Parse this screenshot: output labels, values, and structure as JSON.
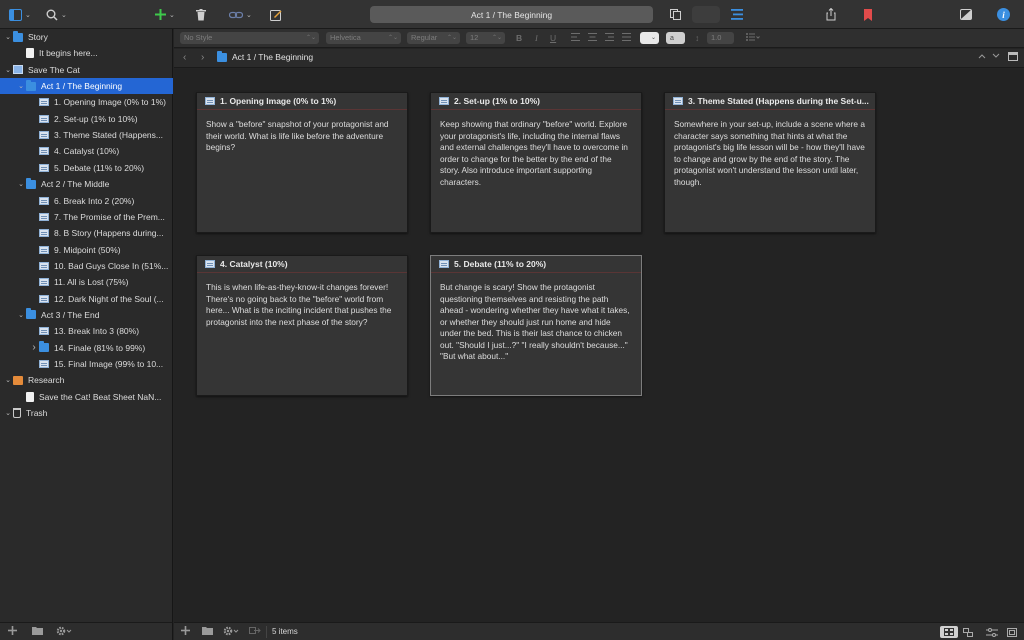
{
  "toolbar": {
    "title": "Act 1 / The Beginning",
    "colors": {
      "add": "#3ec94b",
      "bookmark": "#e24b4b",
      "info": "#3b8fe0",
      "binder": "#3b8fe0"
    }
  },
  "binder": {
    "items": [
      {
        "label": "Story",
        "depth": 0,
        "icon": "folder",
        "disclosure": "v"
      },
      {
        "label": "It begins here...",
        "depth": 1,
        "icon": "doc",
        "disclosure": ""
      },
      {
        "label": "Save The Cat",
        "depth": 0,
        "icon": "book",
        "disclosure": "v"
      },
      {
        "label": "Act 1 / The Beginning",
        "depth": 1,
        "icon": "folder",
        "disclosure": "v",
        "selected": true
      },
      {
        "label": "1. Opening Image (0% to 1%)",
        "depth": 2,
        "icon": "text",
        "disclosure": ""
      },
      {
        "label": "2. Set-up (1% to 10%)",
        "depth": 2,
        "icon": "text",
        "disclosure": ""
      },
      {
        "label": "3. Theme Stated (Happens...",
        "depth": 2,
        "icon": "text",
        "disclosure": ""
      },
      {
        "label": "4. Catalyst (10%)",
        "depth": 2,
        "icon": "text",
        "disclosure": ""
      },
      {
        "label": "5. Debate (11% to 20%)",
        "depth": 2,
        "icon": "text",
        "disclosure": ""
      },
      {
        "label": "Act 2 / The Middle",
        "depth": 1,
        "icon": "folder",
        "disclosure": "v"
      },
      {
        "label": "6. Break Into 2 (20%)",
        "depth": 2,
        "icon": "text",
        "disclosure": ""
      },
      {
        "label": "7. The Promise of the Prem...",
        "depth": 2,
        "icon": "text",
        "disclosure": ""
      },
      {
        "label": "8. B Story (Happens during...",
        "depth": 2,
        "icon": "text",
        "disclosure": ""
      },
      {
        "label": "9. Midpoint (50%)",
        "depth": 2,
        "icon": "text",
        "disclosure": ""
      },
      {
        "label": "10. Bad Guys Close In (51%...",
        "depth": 2,
        "icon": "text",
        "disclosure": ""
      },
      {
        "label": "11. All is Lost (75%)",
        "depth": 2,
        "icon": "text",
        "disclosure": ""
      },
      {
        "label": "12. Dark Night of the Soul (...",
        "depth": 2,
        "icon": "text",
        "disclosure": ""
      },
      {
        "label": "Act 3 / The End",
        "depth": 1,
        "icon": "folder",
        "disclosure": "v"
      },
      {
        "label": "13. Break Into 3 (80%)",
        "depth": 2,
        "icon": "text",
        "disclosure": ""
      },
      {
        "label": "14. Finale (81% to 99%)",
        "depth": 2,
        "icon": "folder",
        "disclosure": ">"
      },
      {
        "label": "15. Final Image (99% to 10...",
        "depth": 2,
        "icon": "text",
        "disclosure": ""
      },
      {
        "label": "Research",
        "depth": 0,
        "icon": "research",
        "disclosure": "v"
      },
      {
        "label": "Save the Cat! Beat Sheet NaN...",
        "depth": 1,
        "icon": "doc",
        "disclosure": ""
      },
      {
        "label": "Trash",
        "depth": 0,
        "icon": "trash",
        "disclosure": "v"
      }
    ]
  },
  "formatbar": {
    "style": "No Style",
    "font": "Helvetica",
    "weight": "Regular",
    "size": "12",
    "bold": "B",
    "italic": "I",
    "underline": "U",
    "line_spacing": "1.0"
  },
  "header": {
    "back": "‹",
    "forward": "›",
    "breadcrumb": "Act 1 / The Beginning"
  },
  "cards": [
    {
      "title": "1. Opening Image (0% to 1%)",
      "body": "Show a \"before\" snapshot of your protagonist and their world. What is life like before the adventure begins?"
    },
    {
      "title": "2. Set-up (1% to 10%)",
      "body": "Keep showing that ordinary \"before\" world. Explore your protagonist's life, including the internal flaws and external challenges they'll have to overcome in order to change for the better by the end of the story. Also introduce important supporting characters."
    },
    {
      "title": "3. Theme Stated (Happens during the Set-u...",
      "body": "Somewhere in your set-up, include a scene where a character says something that hints at what the protagonist's big life lesson will be - how they'll have to change and grow by the end of the story. The protagonist won't understand the lesson until later, though."
    },
    {
      "title": "4. Catalyst (10%)",
      "body": "This is when life-as-they-know-it changes forever! There's no going back to the \"before\" world from here... What is the inciting incident that pushes the protagonist into the next phase of the story?"
    },
    {
      "title": "5. Debate (11% to 20%)",
      "body": "But change is scary! Show the protagonist questioning themselves and resisting the path ahead - wondering whether they have what it takes, or whether they should just run home and hide under the bed. This is their last chance to chicken out. \"Should I just...?\" \"I really shouldn't because...\" \"But what about...\"",
      "selected": true
    }
  ],
  "footer": {
    "count": "5 items"
  }
}
